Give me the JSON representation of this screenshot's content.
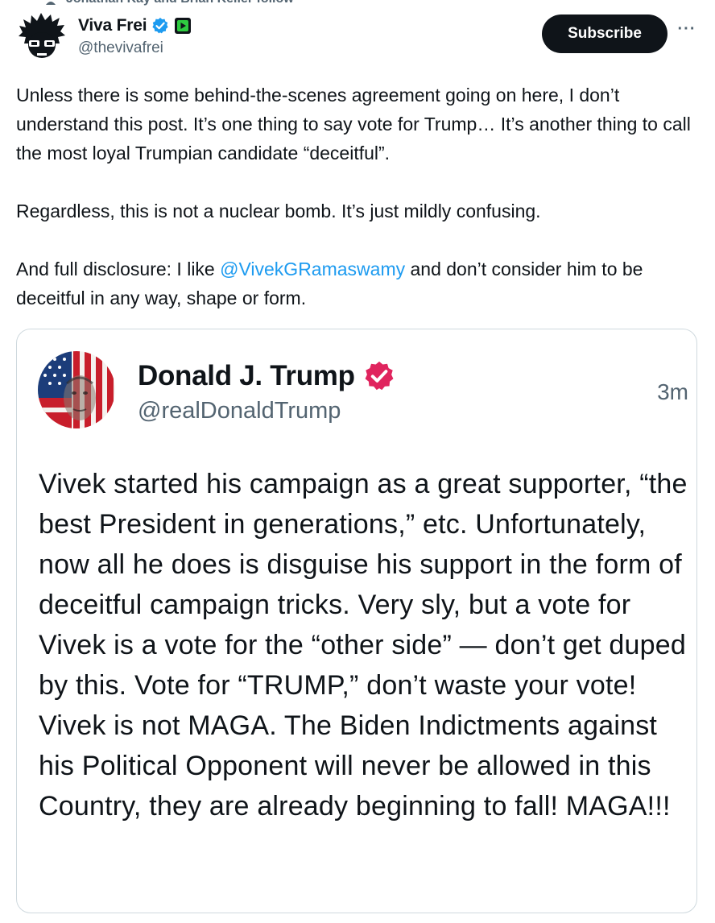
{
  "social_context": {
    "text": "Jonathan Kay and Brian Keller follow"
  },
  "author": {
    "display_name": "Viva Frei",
    "handle": "@thevivafrei",
    "verified_color": "#1d9bf0",
    "subscription_badge_color": "#2ecc40"
  },
  "actions": {
    "subscribe_label": "Subscribe",
    "more_label": "···"
  },
  "tweet": {
    "paragraph_1": "Unless there is some behind-the-scenes  agreement going on here, I don’t understand this post. It’s one thing to say vote for Trump… It’s another thing to call the most loyal Trumpian candidate “deceitful”.",
    "paragraph_2": "Regardless, this is not a nuclear bomb. It’s just mildly confusing.",
    "paragraph_3_before": "And full disclosure: I like ",
    "mention": "@VivekGRamaswamy",
    "paragraph_3_after": " and don’t consider him to be deceitful in any way, shape or form."
  },
  "embedded_post": {
    "display_name": "Donald J. Trump",
    "handle": "@realDonaldTrump",
    "timestamp": "3m",
    "verified_color": "#e0245e",
    "text": "Vivek started his campaign as a great supporter, “the best President in generations,” etc. Unfortunately, now all he does is disguise his support in the form of deceitful campaign tricks. Very sly, but a vote for Vivek is a vote for the “other side” — don’t get duped by this. Vote for “TRUMP,” don’t waste your vote! Vivek is not MAGA. The Biden Indictments against his Political Opponent will never be allowed in this Country, they are already beginning to fall! MAGA!!!"
  },
  "icons": {
    "person": "person-icon",
    "verified": "verified-badge-icon",
    "subscription": "subscription-badge-icon",
    "more": "more-icon"
  }
}
